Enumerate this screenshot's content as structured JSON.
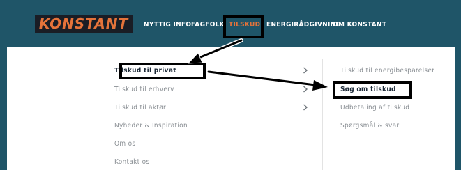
{
  "logo": {
    "text": "KONSTANT"
  },
  "nav": {
    "items": [
      {
        "label": "NYTTIG INFO"
      },
      {
        "label": "FAGFOLK"
      },
      {
        "label": "TILSKUD"
      },
      {
        "label": "ENERGIRÅDGIVNING"
      },
      {
        "label": "OM KONSTANT"
      }
    ],
    "active": "TILSKUD"
  },
  "menu": {
    "items": [
      {
        "label": "Tilskud til privat"
      },
      {
        "label": "Tilskud til erhverv"
      },
      {
        "label": "Tilskud til aktør"
      },
      {
        "label": "Nyheder & Inspiration"
      },
      {
        "label": "Om os"
      },
      {
        "label": "Kontakt os"
      }
    ]
  },
  "submenu": {
    "items": [
      {
        "label": "Tilskud til energibesparelser"
      },
      {
        "label": "Søg om tilskud"
      },
      {
        "label": "Udbetaling af tilskud"
      },
      {
        "label": "Spørgsmål & svar"
      }
    ]
  },
  "colors": {
    "header_bg": "#1f5568",
    "accent": "#e5733a",
    "logo_bg": "#1a1d25",
    "annotation": "#000000"
  },
  "icons": [
    "chevron-right-icon",
    "arrow-annotation"
  ]
}
